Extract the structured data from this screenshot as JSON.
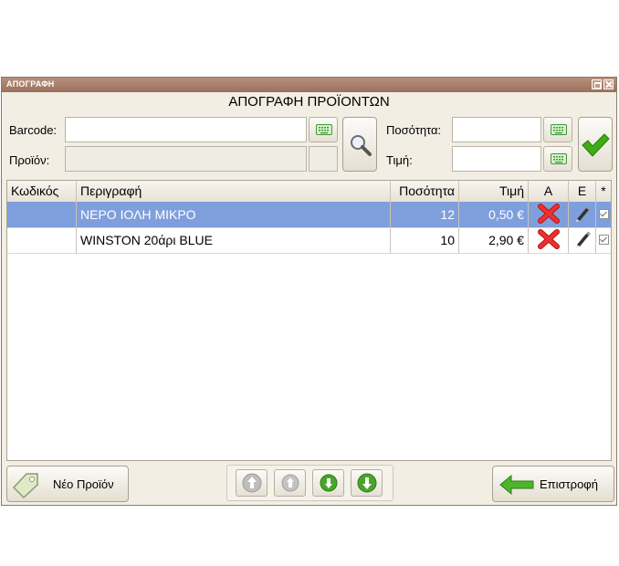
{
  "window": {
    "title": "ΑΠΟΓΡΑΦΗ"
  },
  "heading": "ΑΠΟΓΡΑΦΗ ΠΡΟΪΟΝΤΩΝ",
  "form": {
    "barcode_label": "Barcode:",
    "barcode_value": "",
    "product_label": "Προϊόν:",
    "product_value": "",
    "quantity_label": "Ποσότητα:",
    "quantity_value": "",
    "price_label": "Τιμή:",
    "price_value": ""
  },
  "table": {
    "columns": [
      "Κωδικός",
      "Περιγραφή",
      "Ποσότητα",
      "Τιμή",
      "Α",
      "Ε",
      "*"
    ],
    "rows": [
      {
        "code": "",
        "description": "ΝΕΡΟ ΙΟΛΗ ΜΙΚΡΟ",
        "quantity": "12",
        "price": "0,50 €",
        "selected": true
      },
      {
        "code": "",
        "description": "WINSTON 20άρι BLUE",
        "quantity": "10",
        "price": "2,90 €",
        "selected": false
      }
    ]
  },
  "footer": {
    "new_product_label": "Νέο Προϊόν",
    "back_label": "Επιστροφή"
  },
  "icons": {
    "keyboard": "keyboard-icon",
    "search": "magnifier-icon",
    "confirm": "green-check-icon",
    "delete": "red-x-icon",
    "edit": "pen-icon",
    "tag": "tag-icon",
    "back": "green-left-arrow-icon"
  },
  "colors": {
    "accent_selected": "#7f9fdc",
    "titlebar": "#a87d6c",
    "confirm_green": "#3dad17",
    "delete_red": "#e02020"
  }
}
